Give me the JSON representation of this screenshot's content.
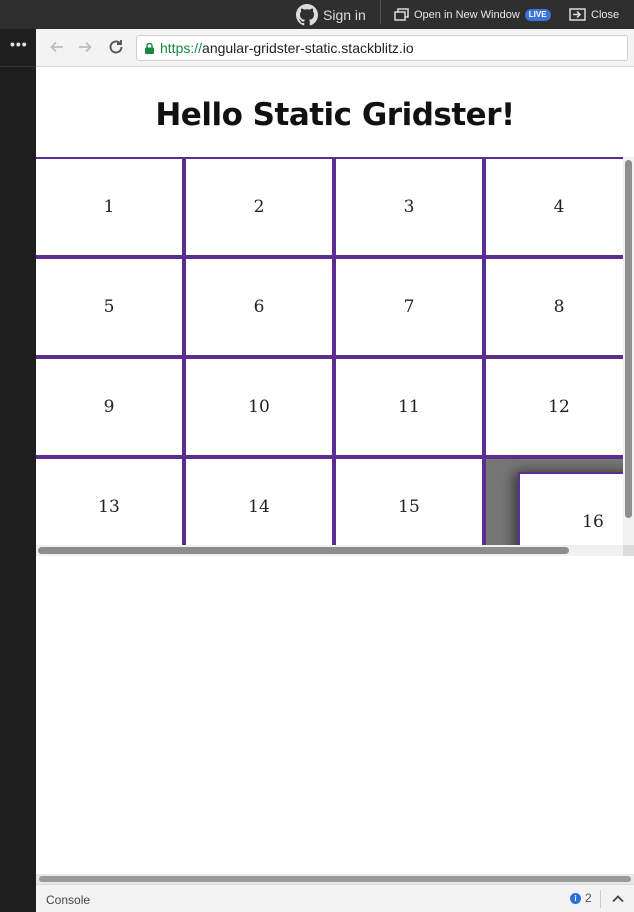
{
  "topbar": {
    "signin_label": "Sign in",
    "open_window_label": "Open in New Window",
    "live_badge": "LIVE",
    "close_label": "Close"
  },
  "browser": {
    "url_scheme": "https://",
    "url_host": "angular-gridster-static.stackblitz.io"
  },
  "page": {
    "heading": "Hello Static Gridster!",
    "cells": [
      "1",
      "2",
      "3",
      "4",
      "5",
      "6",
      "7",
      "8",
      "9",
      "10",
      "11",
      "12",
      "13",
      "14",
      "15",
      "16"
    ]
  },
  "console": {
    "label": "Console",
    "count": "2"
  },
  "colors": {
    "grid_border": "#5c2e91",
    "url_scheme": "#198a3d",
    "live_badge": "#3b73d9"
  }
}
